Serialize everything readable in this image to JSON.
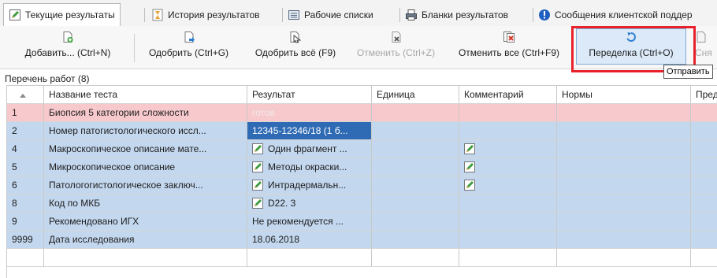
{
  "tabs": [
    {
      "label": "Текущие результаты",
      "icon": "pencil-note-icon",
      "active": true
    },
    {
      "label": "История результатов",
      "icon": "hourglass-icon"
    },
    {
      "label": "Рабочие списки",
      "icon": "worklist-icon"
    },
    {
      "label": "Бланки результатов",
      "icon": "printer-icon"
    },
    {
      "label": "Сообщения клиентской поддер",
      "icon": "info-icon"
    }
  ],
  "toolbar": {
    "add": "Добавить... (Ctrl+N)",
    "approve": "Одобрить (Ctrl+G)",
    "approve_all": "Одобрить всё (F9)",
    "cancel": "Отменить (Ctrl+Z)",
    "cancel_all": "Отменить все (Ctrl+F9)",
    "redo": "Переделка (Ctrl+O)",
    "remove_cut": "Сня"
  },
  "tooltip": "Отправить",
  "list_caption": "Перечень работ (8)",
  "columns": [
    "",
    "Название теста",
    "Результат",
    "Единица",
    "Комментарий",
    "Нормы",
    "Пред"
  ],
  "rows": [
    {
      "num": "1",
      "name": "Биопсия 5 категории сложности",
      "result": "готов",
      "note": false,
      "comment_note": false,
      "style": "pink"
    },
    {
      "num": "2",
      "name": "Номер патогистологического иссл...",
      "result": "12345-12346/18 (1 б...",
      "note": false,
      "comment_note": false,
      "style": "blue"
    },
    {
      "num": "4",
      "name": "Макроскопическое описание мате...",
      "result": "Один фрагмент ...",
      "note": true,
      "comment_note": true,
      "style": "blue"
    },
    {
      "num": "5",
      "name": "Микроскопическое описание",
      "result": "Методы окраски...",
      "note": true,
      "comment_note": true,
      "style": "blue"
    },
    {
      "num": "6",
      "name": "Патологогистологическое заключ...",
      "result": "Интрадермальн...",
      "note": true,
      "comment_note": true,
      "style": "blue"
    },
    {
      "num": "8",
      "name": "Код по МКБ",
      "result": "D22. 3",
      "note": true,
      "comment_note": false,
      "style": "blue"
    },
    {
      "num": "9",
      "name": "Рекомендовано ИГХ",
      "result": "Не рекомендуется ...",
      "note": false,
      "comment_note": false,
      "style": "blue"
    },
    {
      "num": "9999",
      "name": "Дата исследования",
      "result": "18.06.2018",
      "note": false,
      "comment_note": false,
      "style": "blue"
    }
  ],
  "colors": {
    "pink_row": "#f7c9cd",
    "blue_row": "#c3d7ee",
    "selected": "#2f6bb4",
    "highlight_box": "#e8212b"
  }
}
